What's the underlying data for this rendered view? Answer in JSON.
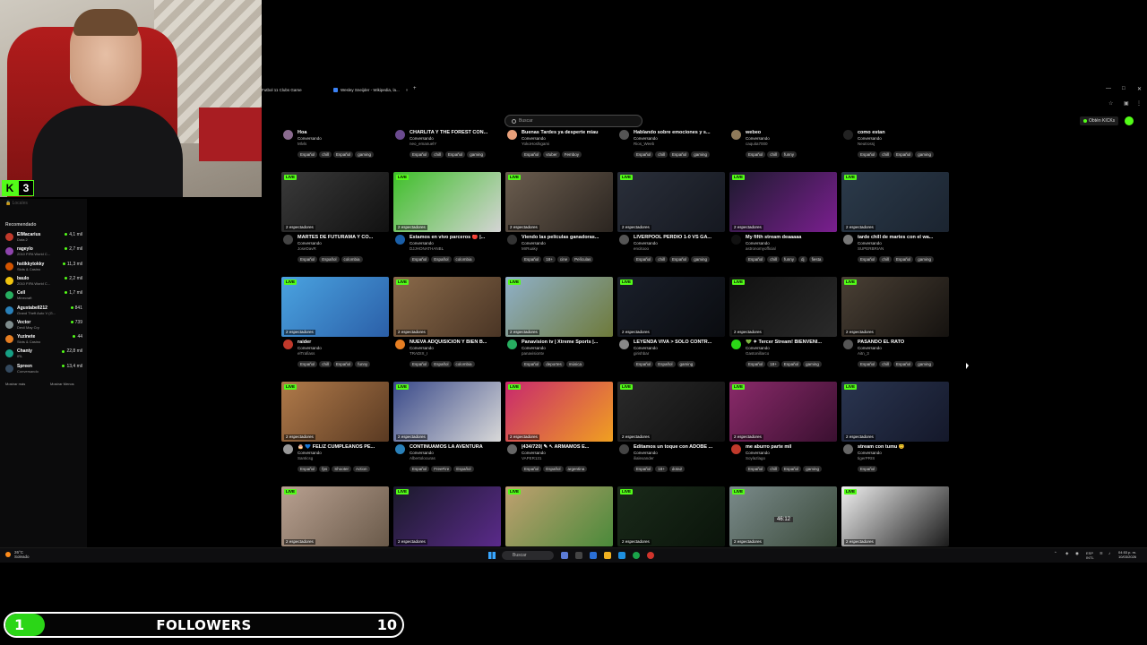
{
  "webcam": {
    "kick_level": "3",
    "kick_letter": "K"
  },
  "sidebar": {
    "lock_text": "Locales",
    "heading": "Recomendado",
    "items": [
      {
        "name": "ElMacarius",
        "category": "Dota 2",
        "viewers": "4,1 mil",
        "color": "#c0392b"
      },
      {
        "name": "rageylo",
        "category": "2010 FIFA World C...",
        "viewers": "2,7 mil",
        "color": "#8e44ad"
      },
      {
        "name": "hstikkytokky",
        "category": "Slots & Casino",
        "viewers": "11,3 mil",
        "color": "#d35400"
      },
      {
        "name": "baulo",
        "category": "2010 FIFA World C...",
        "viewers": "2,2 mil",
        "color": "#f1c40f"
      },
      {
        "name": "Cell",
        "category": "Minecraft",
        "viewers": "1,7 mil",
        "color": "#27ae60"
      },
      {
        "name": "Agustabell212",
        "category": "Grand Theft Auto V (G...",
        "viewers": "841",
        "color": "#2980b9"
      },
      {
        "name": "Vector",
        "category": "Devil May Cry",
        "viewers": "739",
        "color": "#7f8c8d"
      },
      {
        "name": "Yuzinete",
        "category": "Slots & Casino",
        "viewers": "44",
        "color": "#e67e22"
      },
      {
        "name": "Chanty",
        "category": "IRL",
        "viewers": "22,8 mil",
        "color": "#16a085"
      },
      {
        "name": "Spreen",
        "category": "Conversando",
        "viewers": "13,4 mil",
        "color": "#34495e"
      }
    ],
    "show_more": "Mostrar más",
    "show_less": "Mostrar Menos"
  },
  "browser": {
    "tabs": [
      {
        "title": "Futbol 11 Clubs Game"
      },
      {
        "title": "Wesley Sneijder - Wikipedia, la...",
        "close": "×"
      }
    ],
    "new_tab": "+",
    "window_controls": [
      "—",
      "□",
      "✕"
    ],
    "search_placeholder": "Buscar",
    "kicks_button": "Obtén KICKs"
  },
  "cards": [
    {
      "title": "Hoa",
      "category": "Conversando",
      "user": "Mlvls",
      "tags": [
        "Español",
        "chill",
        "Español",
        "gaming"
      ],
      "avatar": "#8a6b8f"
    },
    {
      "title": "CHARLITA Y THE FOREST CON...",
      "category": "Conversando",
      "user": "neo_emanuelY",
      "tags": [
        "Español",
        "chill",
        "Español",
        "gaming"
      ],
      "avatar": "#6b4a8f"
    },
    {
      "title": "Buenas Tardes ya desperte miau",
      "category": "Conversando",
      "user": "YokoHoshigami",
      "tags": [
        "Español",
        "vtuber",
        "Femboy"
      ],
      "avatar": "#e8a07a"
    },
    {
      "title": "Hablando sobre emociones y s...",
      "category": "Conversando",
      "user": "Rios_Weeb",
      "tags": [
        "Español",
        "chill",
        "Español",
        "gaming"
      ],
      "avatar": "#555"
    },
    {
      "title": "webeo",
      "category": "Conversando",
      "user": "caquita7000",
      "tags": [
        "Español",
        "chill",
        "funny"
      ],
      "avatar": "#8f7a5a"
    },
    {
      "title": "como estan",
      "category": "Conversando",
      "user": "Neutrossj",
      "tags": [
        "Español",
        "chill",
        "Español",
        "gaming"
      ],
      "avatar": "#222"
    },
    {
      "title": "MARTES DE FUTURAMA Y CO...",
      "category": "Conversando",
      "user": "JoseDavR",
      "tags": [
        "Español",
        "Español",
        "colombia"
      ],
      "avatar": "#444",
      "viewers": "2 espectadores",
      "thumb": [
        "#3a3a3a",
        "#111"
      ]
    },
    {
      "title": "Estamos en vivo parceros 🔴 |...",
      "category": "Conversando",
      "user": "DJJHONATHANBL",
      "tags": [
        "Español",
        "Español",
        "colombia"
      ],
      "avatar": "#1a5fa8",
      "viewers": "2 espectadores",
      "thumb": [
        "#3fbf2a",
        "#d4d4d4"
      ]
    },
    {
      "title": "Viendo las películas ganadoras...",
      "category": "Conversando",
      "user": "MrRuaky",
      "tags": [
        "Español",
        "18+",
        "cine",
        "Películas"
      ],
      "avatar": "#333",
      "viewers": "2 espectadores",
      "thumb": [
        "#6b5d4f",
        "#2b2520"
      ]
    },
    {
      "title": "LIVERPOOL PERDIO 1-0 VS GA...",
      "category": "Conversando",
      "user": "encitooo",
      "tags": [
        "Español",
        "chill",
        "Español",
        "gaming"
      ],
      "avatar": "#555",
      "viewers": "2 espectadores",
      "thumb": [
        "#2a2f3a",
        "#151820"
      ]
    },
    {
      "title": "My fifth stream deaaaaa",
      "category": "Conversando",
      "user": "astronomyofficial",
      "tags": [
        "Español",
        "chill",
        "funny",
        "dj",
        "fiesta"
      ],
      "avatar": "#111",
      "viewers": "2 espectadores",
      "thumb": [
        "#1d1a2e",
        "#7a1f8f"
      ]
    },
    {
      "title": "tarde chill de martes con el wa...",
      "category": "Conversando",
      "user": "SUPERBRIAN",
      "tags": [
        "Español",
        "chill",
        "Español",
        "gaming"
      ],
      "avatar": "#777",
      "viewers": "2 espectadores",
      "thumb": [
        "#2b3a4a",
        "#1b2430"
      ]
    },
    {
      "title": "raider",
      "category": "Conversando",
      "user": "elTrafiass",
      "tags": [
        "Español",
        "chill",
        "Español",
        "funny"
      ],
      "avatar": "#c0392b",
      "viewers": "2 espectadores",
      "thumb": [
        "#4aa3e0",
        "#2b5fa8"
      ]
    },
    {
      "title": "NUEVA ADQUISICIÓN Y BIEN B...",
      "category": "Conversando",
      "user": "TRADIX_I",
      "tags": [
        "Español",
        "Español",
        "colombia"
      ],
      "avatar": "#e67e22",
      "viewers": "2 espectadores",
      "thumb": [
        "#8a6a4a",
        "#4a3525"
      ]
    },
    {
      "title": "Panavision tv | Xtreme Sports |...",
      "category": "Conversando",
      "user": "panavisiontv",
      "tags": [
        "Español",
        "deportes",
        "música"
      ],
      "avatar": "#27ae60",
      "viewers": "2 espectadores",
      "thumb": [
        "#8fb0c8",
        "#6e7a3a"
      ]
    },
    {
      "title": "LEYENDA VIVA > SOLO CONTR...",
      "category": "Conversando",
      "user": "girishbar",
      "tags": [
        "Español",
        "Español",
        "gaming"
      ],
      "avatar": "#888",
      "viewers": "2 espectadores",
      "thumb": [
        "#1a1f2a",
        "#0a0c10"
      ]
    },
    {
      "title": "💚 ✦ Tercer Stream! BIENVENI...",
      "category": "Conversando",
      "user": "Gastonillarco",
      "tags": [
        "Español",
        "18+",
        "Español",
        "gaming"
      ],
      "avatar": "#2bd617",
      "viewers": "2 espectadores",
      "thumb": [
        "#101010",
        "#2a2a2a"
      ]
    },
    {
      "title": "PASANDO EL RATO",
      "category": "Conversando",
      "user": "Aitn_3",
      "tags": [
        "Español",
        "chill",
        "Español",
        "gaming"
      ],
      "avatar": "#555",
      "viewers": "2 espectadores",
      "thumb": [
        "#4a4035",
        "#15120f"
      ]
    },
    {
      "title": "🎂 💙 FELIZ CUMPLEAÑOS PE...",
      "category": "Conversando",
      "user": "Santicsg",
      "tags": [
        "Español",
        "fps",
        "Shooter",
        "Action"
      ],
      "avatar": "#999",
      "viewers": "2 espectadores",
      "thumb": [
        "#b07a4a",
        "#5a3a22"
      ]
    },
    {
      "title": "CONTINUAMOS LA AVENTURA",
      "category": "Conversando",
      "user": "Albertolocuras",
      "tags": [
        "Español",
        "FreeFire",
        "Español"
      ],
      "avatar": "#2980b9",
      "viewers": "2 espectadores",
      "thumb": [
        "#3a4a8a",
        "#d8d8d8"
      ]
    },
    {
      "title": "|434/720| ✎ ↖ ARMAMOS E...",
      "category": "Conversando",
      "user": "VAPER131",
      "tags": [
        "Español",
        "Español",
        "argentina"
      ],
      "avatar": "#666",
      "viewers": "2 espectadores",
      "thumb": [
        "#c8286e",
        "#f0a020"
      ]
    },
    {
      "title": "Editamos un toque con ADOBE ...",
      "category": "Conversando",
      "user": "ilialexander",
      "tags": [
        "Español",
        "18+",
        "dota2"
      ],
      "avatar": "#444",
      "viewers": "2 espectadores",
      "thumb": [
        "#2a2a2a",
        "#0f0f0f"
      ]
    },
    {
      "title": "me aburro parte mil",
      "category": "Conversando",
      "user": "Soylazlago",
      "tags": [
        "Español",
        "chill",
        "Español",
        "gaming"
      ],
      "avatar": "#c0392b",
      "viewers": "2 espectadores",
      "thumb": [
        "#8a2a6a",
        "#3a1030"
      ]
    },
    {
      "title": "stream con tumu 😊",
      "category": "Conversando",
      "user": "tigerPRIS",
      "tags": [
        "Español"
      ],
      "avatar": "#666",
      "viewers": "2 espectadores",
      "thumb": [
        "#2a3550",
        "#14182a"
      ]
    },
    {
      "viewers": "2 espectadores",
      "thumb": [
        "#b8a090",
        "#6a5a4a"
      ]
    },
    {
      "viewers": "2 espectadores",
      "thumb": [
        "#1a1a2a",
        "#5a2a8a"
      ]
    },
    {
      "viewers": "",
      "thumb": [
        "#c0a070",
        "#4a8a3a"
      ]
    },
    {
      "viewers": "2 espectadores",
      "thumb": [
        "#1a2a1a",
        "#0a140a"
      ]
    },
    {
      "viewers": "2 espectadores",
      "thumb": [
        "#7a8a8a",
        "#3a4a3a"
      ],
      "overlay": "46:12"
    },
    {
      "viewers": "2 espectadores",
      "thumb": [
        "#f0f0f0",
        "#1a1a1a"
      ]
    }
  ],
  "taskbar": {
    "weather_temp": "26°C",
    "weather_desc": "Soleado",
    "search": "Buscar",
    "lang_top": "ESP",
    "lang_bottom": "INTL",
    "time": "04:53 p. m.",
    "date": "10/03/2026"
  },
  "followers_goal": {
    "current": "1",
    "label": "FOLLOWERS",
    "target": "10",
    "progress": 0.1
  }
}
